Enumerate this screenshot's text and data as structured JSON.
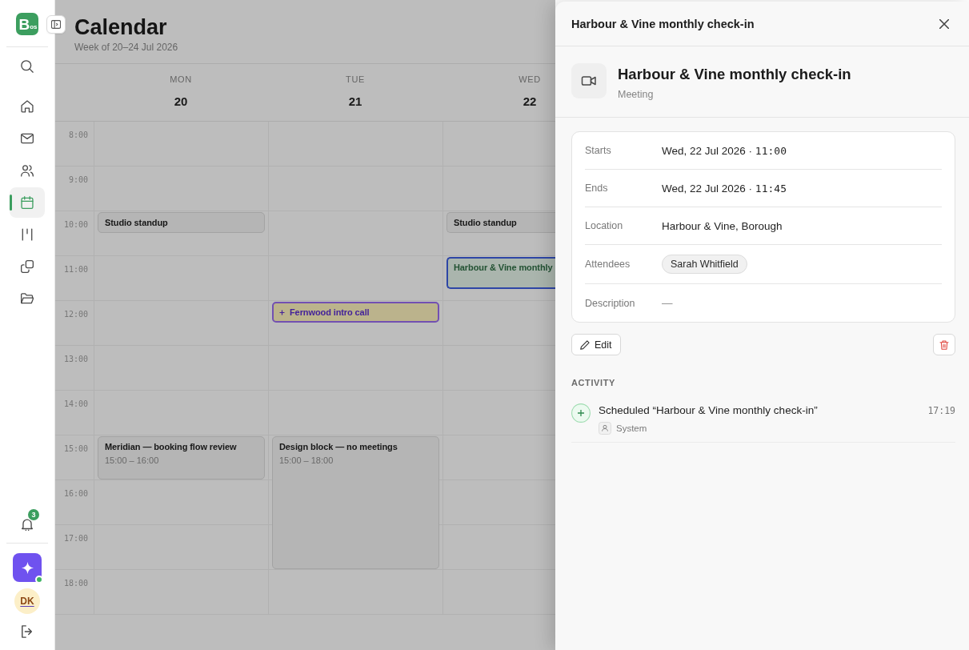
{
  "sidebar": {
    "logo": "B$_{os}$",
    "nav": [
      {
        "kind": "home",
        "selected": false
      },
      {
        "kind": "mail",
        "selected": false
      },
      {
        "kind": "people",
        "selected": false
      },
      {
        "kind": "calendar",
        "selected": true
      },
      {
        "kind": "board",
        "selected": false
      },
      {
        "kind": "copies",
        "selected": false
      },
      {
        "kind": "folder",
        "selected": false
      }
    ],
    "notifications": {
      "count": "3"
    },
    "assistant": {
      "online": true
    },
    "user": {
      "initials": "DK"
    }
  },
  "calendar": {
    "title": "Calendar",
    "subtitle": "Week of 20–24 Jul 2026",
    "days": [
      {
        "name": "MON",
        "date": "20"
      },
      {
        "name": "TUE",
        "date": "21"
      },
      {
        "name": "WED",
        "date": "22"
      }
    ],
    "rows": [
      {
        "hour": "8:00",
        "cells": [
          {},
          {},
          {}
        ]
      },
      {
        "hour": "9:00",
        "cells": [
          {},
          {},
          {}
        ]
      },
      {
        "hour": "10:00",
        "cells": [
          {
            "events": [
              {
                "kind": "plain",
                "title": "Studio standup",
                "selected": false
              }
            ]
          },
          {},
          {
            "events": [
              {
                "kind": "plain",
                "title": "Studio standup",
                "selected": false
              }
            ]
          }
        ]
      },
      {
        "hour": "11:00",
        "cells": [
          {},
          {},
          {
            "events": [
              {
                "kind": "meeting",
                "title": "Harbour & Vine monthly",
                "selected": true
              }
            ]
          }
        ]
      },
      {
        "hour": "12:00",
        "cells": [
          {},
          {
            "events": [
              {
                "kind": "proposed",
                "title": "Fernwood intro call",
                "selected": false
              }
            ]
          },
          {}
        ]
      },
      {
        "hour": "13:00",
        "cells": [
          {},
          {},
          {}
        ]
      },
      {
        "hour": "14:00",
        "cells": [
          {},
          {},
          {}
        ]
      },
      {
        "hour": "15:00",
        "cells": [
          {
            "events": [
              {
                "kind": "plain",
                "title": "Meridian — booking flow review",
                "time": "15:00 – 16:00",
                "selected": false
              }
            ]
          },
          {
            "events": [
              {
                "kind": "plain",
                "title": "Design block — no meetings",
                "time": "15:00 – 18:00",
                "selected": false
              }
            ]
          },
          {}
        ]
      },
      {
        "hour": "16:00",
        "cells": [
          {},
          {},
          {}
        ]
      },
      {
        "hour": "17:00",
        "cells": [
          {},
          {},
          {}
        ]
      },
      {
        "hour": "18:00",
        "cells": [
          {},
          {},
          {}
        ]
      }
    ]
  },
  "event_panel": {
    "header_title": "Harbour & Vine monthly check-in",
    "title": "Harbour & Vine monthly check-in",
    "type": "Meeting",
    "details": [
      {
        "kind": "datetime",
        "label": "Starts",
        "value": "Wed, 22 Jul 2026 ·",
        "time": "11:00"
      },
      {
        "kind": "datetime",
        "label": "Ends",
        "value": "Wed, 22 Jul 2026 ·",
        "time": "11:45"
      },
      {
        "kind": "text",
        "label": "Location",
        "value": "Harbour & Vine, Borough"
      },
      {
        "kind": "people",
        "label": "Attendees",
        "people": [
          "Sarah Whitfield"
        ]
      },
      {
        "kind": "empty",
        "label": "Description",
        "value": "—"
      }
    ],
    "edit_label": "Edit",
    "activity": {
      "heading": "ACTIVITY",
      "items": [
        {
          "kind": "created",
          "text": "Scheduled “Harbour & Vine monthly check-in”",
          "time": "17:19",
          "actor": "System"
        }
      ]
    }
  }
}
